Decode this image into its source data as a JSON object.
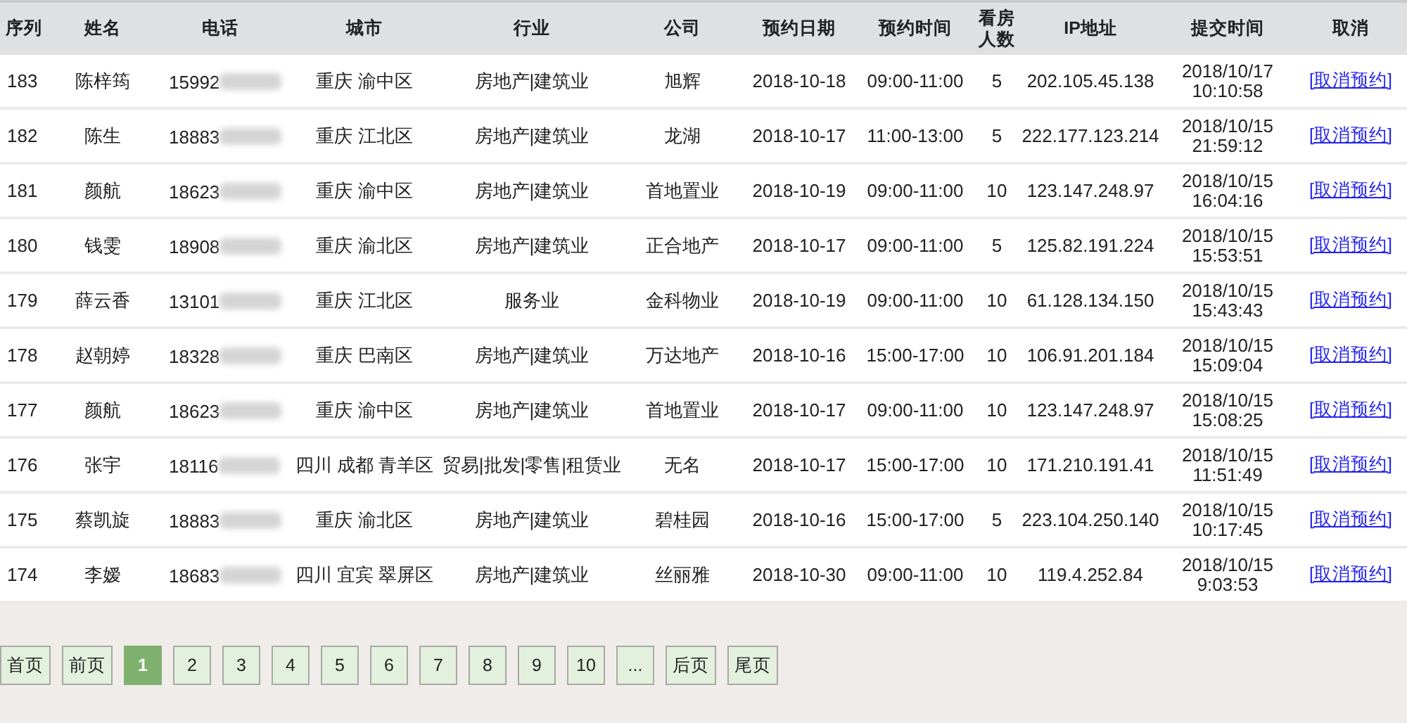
{
  "table": {
    "columns": [
      "序列",
      "姓名",
      "电话",
      "城市",
      "行业",
      "公司",
      "预约日期",
      "预约时间",
      "看房人数",
      "IP地址",
      "提交时间",
      "取消"
    ],
    "rows": [
      {
        "id": "183",
        "name": "陈梓筠",
        "phone": "15992",
        "city": "重庆 渝中区",
        "industry": "房地产|建筑业",
        "company": "旭辉",
        "date": "2018-10-18",
        "time": "09:00-11:00",
        "people": "5",
        "ip": "202.105.45.138",
        "submitted": [
          "2018/10/17",
          "10:10:58"
        ],
        "action": "[取消预约]"
      },
      {
        "id": "182",
        "name": "陈生",
        "phone": "18883",
        "city": "重庆 江北区",
        "industry": "房地产|建筑业",
        "company": "龙湖",
        "date": "2018-10-17",
        "time": "11:00-13:00",
        "people": "5",
        "ip": "222.177.123.214",
        "submitted": [
          "2018/10/15",
          "21:59:12"
        ],
        "action": "[取消预约]"
      },
      {
        "id": "181",
        "name": "颜航",
        "phone": "18623",
        "city": "重庆 渝中区",
        "industry": "房地产|建筑业",
        "company": "首地置业",
        "date": "2018-10-19",
        "time": "09:00-11:00",
        "people": "10",
        "ip": "123.147.248.97",
        "submitted": [
          "2018/10/15",
          "16:04:16"
        ],
        "action": "[取消预约]"
      },
      {
        "id": "180",
        "name": "钱雯",
        "phone": "18908",
        "city": "重庆 渝北区",
        "industry": "房地产|建筑业",
        "company": "正合地产",
        "date": "2018-10-17",
        "time": "09:00-11:00",
        "people": "5",
        "ip": "125.82.191.224",
        "submitted": [
          "2018/10/15",
          "15:53:51"
        ],
        "action": "[取消预约]"
      },
      {
        "id": "179",
        "name": "薛云香",
        "phone": "13101",
        "city": "重庆 江北区",
        "industry": "服务业",
        "company": "金科物业",
        "date": "2018-10-19",
        "time": "09:00-11:00",
        "people": "10",
        "ip": "61.128.134.150",
        "submitted": [
          "2018/10/15",
          "15:43:43"
        ],
        "action": "[取消预约]"
      },
      {
        "id": "178",
        "name": "赵朝婷",
        "phone": "18328",
        "city": "重庆 巴南区",
        "industry": "房地产|建筑业",
        "company": "万达地产",
        "date": "2018-10-16",
        "time": "15:00-17:00",
        "people": "10",
        "ip": "106.91.201.184",
        "submitted": [
          "2018/10/15",
          "15:09:04"
        ],
        "action": "[取消预约]"
      },
      {
        "id": "177",
        "name": "颜航",
        "phone": "18623",
        "city": "重庆 渝中区",
        "industry": "房地产|建筑业",
        "company": "首地置业",
        "date": "2018-10-17",
        "time": "09:00-11:00",
        "people": "10",
        "ip": "123.147.248.97",
        "submitted": [
          "2018/10/15",
          "15:08:25"
        ],
        "action": "[取消预约]"
      },
      {
        "id": "176",
        "name": "张宇",
        "phone": "18116",
        "city": "四川 成都 青羊区",
        "industry": "贸易|批发|零售|租赁业",
        "company": "无名",
        "date": "2018-10-17",
        "time": "15:00-17:00",
        "people": "10",
        "ip": "171.210.191.41",
        "submitted": [
          "2018/10/15",
          "11:51:49"
        ],
        "action": "[取消预约]"
      },
      {
        "id": "175",
        "name": "蔡凯旋",
        "phone": "18883",
        "city": "重庆 渝北区",
        "industry": "房地产|建筑业",
        "company": "碧桂园",
        "date": "2018-10-16",
        "time": "15:00-17:00",
        "people": "5",
        "ip": "223.104.250.140",
        "submitted": [
          "2018/10/15",
          "10:17:45"
        ],
        "action": "[取消预约]"
      },
      {
        "id": "174",
        "name": "李嫒",
        "phone": "18683",
        "city": "四川 宜宾 翠屏区",
        "industry": "房地产|建筑业",
        "company": "丝丽雅",
        "date": "2018-10-30",
        "time": "09:00-11:00",
        "people": "10",
        "ip": "119.4.252.84",
        "submitted": [
          "2018/10/15",
          "9:03:53"
        ],
        "action": "[取消预约]"
      }
    ]
  },
  "pagination": [
    {
      "label": "首页",
      "kind": "nav",
      "selected": false
    },
    {
      "label": "前页",
      "kind": "nav",
      "selected": false
    },
    {
      "label": "1",
      "kind": "page",
      "selected": true
    },
    {
      "label": "2",
      "kind": "page",
      "selected": false
    },
    {
      "label": "3",
      "kind": "page",
      "selected": false
    },
    {
      "label": "4",
      "kind": "page",
      "selected": false
    },
    {
      "label": "5",
      "kind": "page",
      "selected": false
    },
    {
      "label": "6",
      "kind": "page",
      "selected": false
    },
    {
      "label": "7",
      "kind": "page",
      "selected": false
    },
    {
      "label": "8",
      "kind": "page",
      "selected": false
    },
    {
      "label": "9",
      "kind": "page",
      "selected": false
    },
    {
      "label": "10",
      "kind": "page",
      "selected": false
    },
    {
      "label": "...",
      "kind": "page",
      "selected": false
    },
    {
      "label": "后页",
      "kind": "nav",
      "selected": false
    },
    {
      "label": "尾页",
      "kind": "nav",
      "selected": false
    }
  ]
}
